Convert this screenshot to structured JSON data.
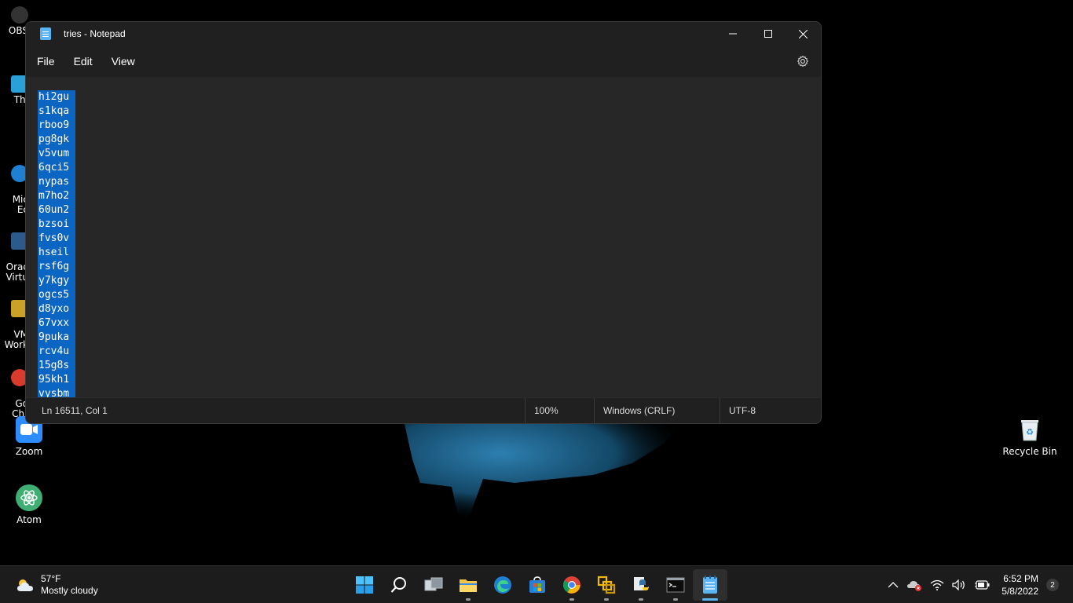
{
  "desktop": {
    "left_icons": [
      {
        "label": "OBS"
      },
      {
        "label": "Thi"
      },
      {
        "label": "Mic\nEc"
      },
      {
        "label": "Orac\nVirtu"
      },
      {
        "label": "VM\nWork"
      },
      {
        "label": "Go\nChr"
      }
    ],
    "zoom": {
      "label": "Zoom"
    },
    "atom": {
      "label": "Atom"
    },
    "recycle_bin": {
      "label": "Recycle Bin"
    }
  },
  "window": {
    "title": "tries - Notepad",
    "menu": {
      "file": "File",
      "edit": "Edit",
      "view": "View"
    },
    "icons": {
      "settings": "gear-icon",
      "minimize": "minimize-icon",
      "maximize": "maximize-icon",
      "close": "close-icon"
    },
    "lines": [
      "hi2gu",
      "s1kqa",
      "rboo9",
      "pg8gk",
      "v5vum",
      "6qci5",
      "nypas",
      "m7ho2",
      "60un2",
      "bzsoi",
      "fvs0v",
      "hseil",
      "rsf6g",
      "y7kgy",
      "ogcs5",
      "d8yxo",
      "67vxx",
      "9puka",
      "rcv4u",
      "15g8s",
      "95kh1",
      "vysbm"
    ],
    "status": {
      "position": "Ln 16511, Col 1",
      "zoom": "100%",
      "line_ending": "Windows (CRLF)",
      "encoding": "UTF-8"
    }
  },
  "taskbar": {
    "weather": {
      "temp": "57°F",
      "condition": "Mostly cloudy"
    },
    "apps": [
      "start",
      "search",
      "task-view",
      "file-explorer",
      "edge",
      "store",
      "chrome",
      "vmware",
      "python",
      "terminal",
      "notepad"
    ],
    "clock": {
      "time": "6:52 PM",
      "date": "5/8/2022"
    },
    "notifications": "2"
  },
  "colors": {
    "selection": "#0a66c2",
    "accent": "#5ab4f4",
    "window_bg": "#272727",
    "chrome_bg": "#202020"
  }
}
